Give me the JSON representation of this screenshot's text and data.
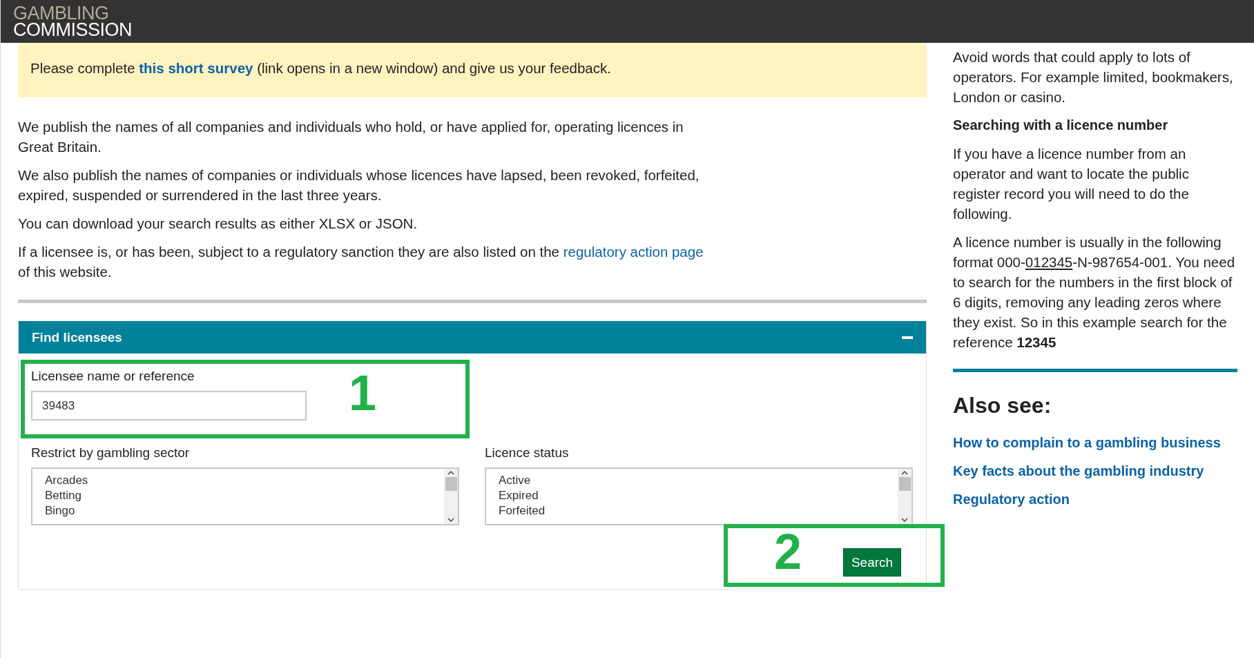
{
  "header": {
    "logo_line_1": "GAMBLING",
    "logo_line_2": "COMMISSION"
  },
  "feedback_banner": {
    "before": "Please complete ",
    "link": "this short survey",
    "after": " (link opens in a new window) and give us your feedback."
  },
  "intro": [
    {
      "text": "We publish the names of all companies and individuals who hold, or have applied for, operating licences in Great Britain."
    },
    {
      "text": "We also publish the names of companies or individuals whose licences have lapsed, been revoked, forfeited, expired, suspended or surrendered in the last three years."
    },
    {
      "text": "You can download your search results as either XLSX or JSON."
    },
    {
      "text": "If a licensee is, or has been, subject to a regulatory sanction they are also listed on the ",
      "link": "regulatory action page",
      "after": " of this website."
    }
  ],
  "find_panel": {
    "title": "Find licensees",
    "expanded": true,
    "name_field": {
      "label": "Licensee name or reference",
      "value": "39483"
    },
    "sector_list": {
      "label": "Restrict by gambling sector",
      "options": [
        "Arcades",
        "Betting",
        "Bingo"
      ]
    },
    "status_list": {
      "label": "Licence status",
      "options": [
        "Active",
        "Expired",
        "Forfeited"
      ]
    },
    "search_button": "Search"
  },
  "annotations": [
    {
      "label": "1"
    },
    {
      "label": "2"
    }
  ],
  "sidebar": {
    "intro": "Avoid words that could apply to lots of operators. For example limited, bookmakers, London or casino.",
    "heading": "Searching with a licence number",
    "paragraph": "If you have a licence number from an operator and want to locate the public register record you will need to do the following.",
    "format_before": "A licence number is usually in the following format 000-",
    "format_underlined": "012345",
    "format_after": "-N-987654-001. You need to search for the numbers in the first block of 6 digits, removing any leading zeros where they exist. So in this example search for the reference **12345**",
    "also_see_title": "Also see:",
    "links": [
      "How to complain to a gambling business",
      "Key facts about the gambling industry",
      "Regulatory action"
    ]
  }
}
